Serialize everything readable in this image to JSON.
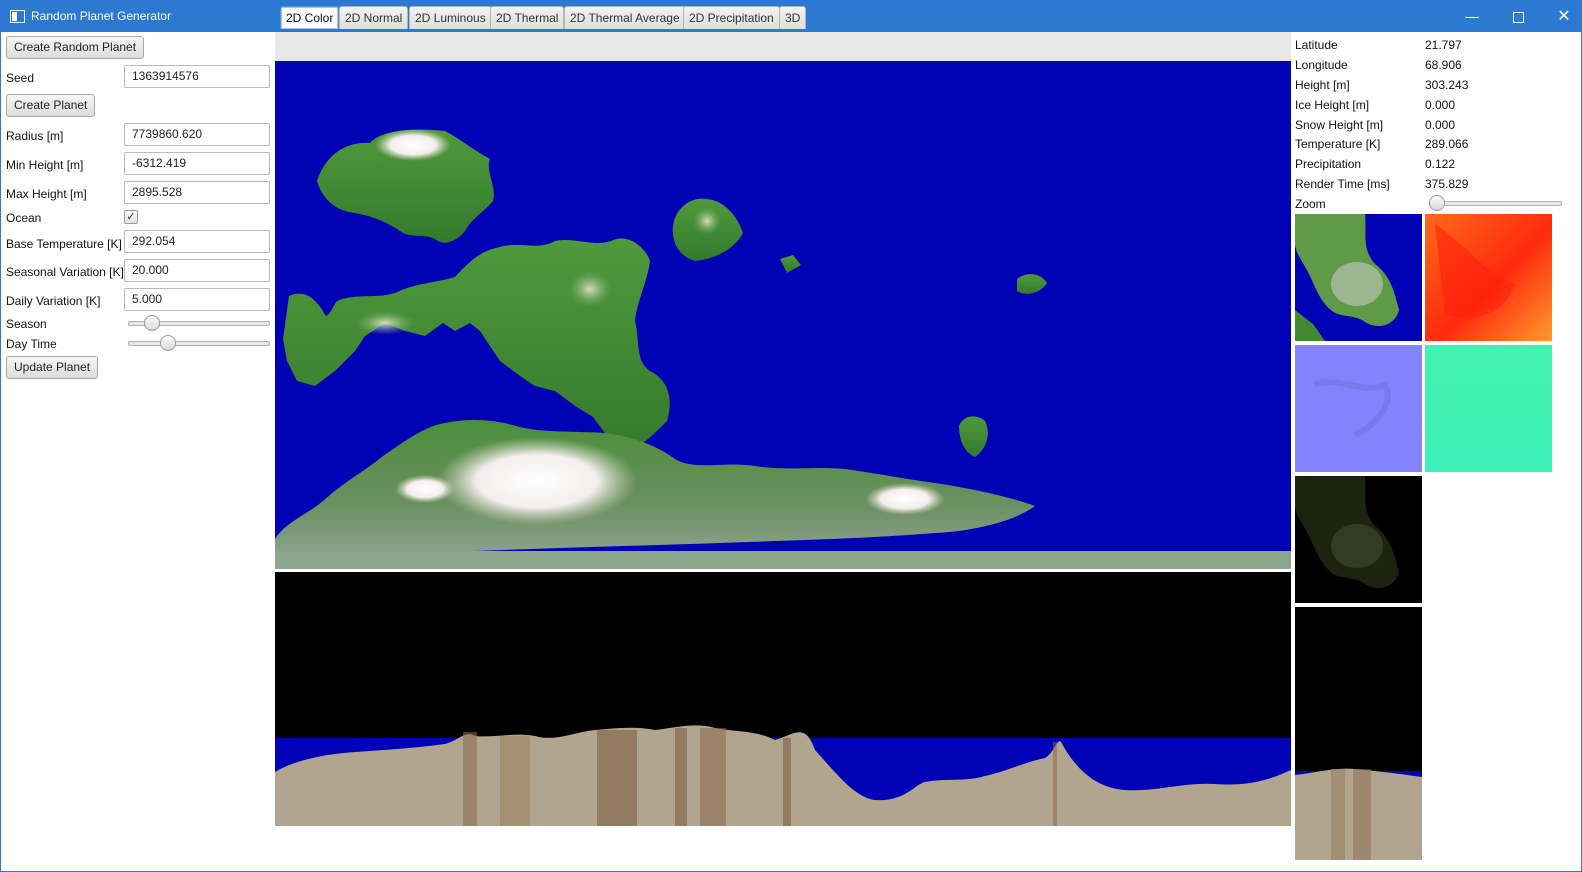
{
  "window": {
    "title": "Random Planet Generator"
  },
  "left_panel": {
    "create_random_button": "Create Random Planet",
    "seed_label": "Seed",
    "seed_value": "1363914576",
    "create_planet_button": "Create Planet",
    "radius_label": "Radius [m]",
    "radius_value": "7739860.620",
    "min_height_label": "Min Height [m]",
    "min_height_value": "-6312.419",
    "max_height_label": "Max Height [m]",
    "max_height_value": "2895.528",
    "ocean_label": "Ocean",
    "ocean_checked": true,
    "base_temp_label": "Base Temperature [K]",
    "base_temp_value": "292.054",
    "seasonal_label": "Seasonal Variation [K]",
    "seasonal_value": "20.000",
    "daily_label": "Daily Variation [K]",
    "daily_value": "5.000",
    "season_label": "Season",
    "season_level": 0.13,
    "daytime_label": "Day Time",
    "daytime_level": 0.25,
    "update_button": "Update Planet"
  },
  "tabs": [
    {
      "label": "2D Color",
      "active": true
    },
    {
      "label": "2D Normal",
      "active": false
    },
    {
      "label": "2D Luminous",
      "active": false
    },
    {
      "label": "2D Thermal",
      "active": false
    },
    {
      "label": "2D Thermal Average",
      "active": false
    },
    {
      "label": "2D Precipitation",
      "active": false
    },
    {
      "label": "3D",
      "active": false
    }
  ],
  "info_panel": {
    "rows": [
      {
        "label": "Latitude",
        "value": "21.797"
      },
      {
        "label": "Longitude",
        "value": "68.906"
      },
      {
        "label": "Height [m]",
        "value": "303.243"
      },
      {
        "label": "Ice Height [m]",
        "value": "0.000"
      },
      {
        "label": "Snow Height [m]",
        "value": "0.000"
      },
      {
        "label": "Temperature [K]",
        "value": "289.066"
      },
      {
        "label": "Precipitation",
        "value": "0.122"
      },
      {
        "label": "Render Time [ms]",
        "value": "375.829"
      }
    ],
    "zoom_label": "Zoom",
    "zoom_level": 0.0
  },
  "colors": {
    "ocean": "#0000b4",
    "land": "#3f8a2e",
    "snow": "#fbf5f5",
    "terrain_cross_section": "#b2a58f",
    "titlebar": "#2b79d0"
  }
}
